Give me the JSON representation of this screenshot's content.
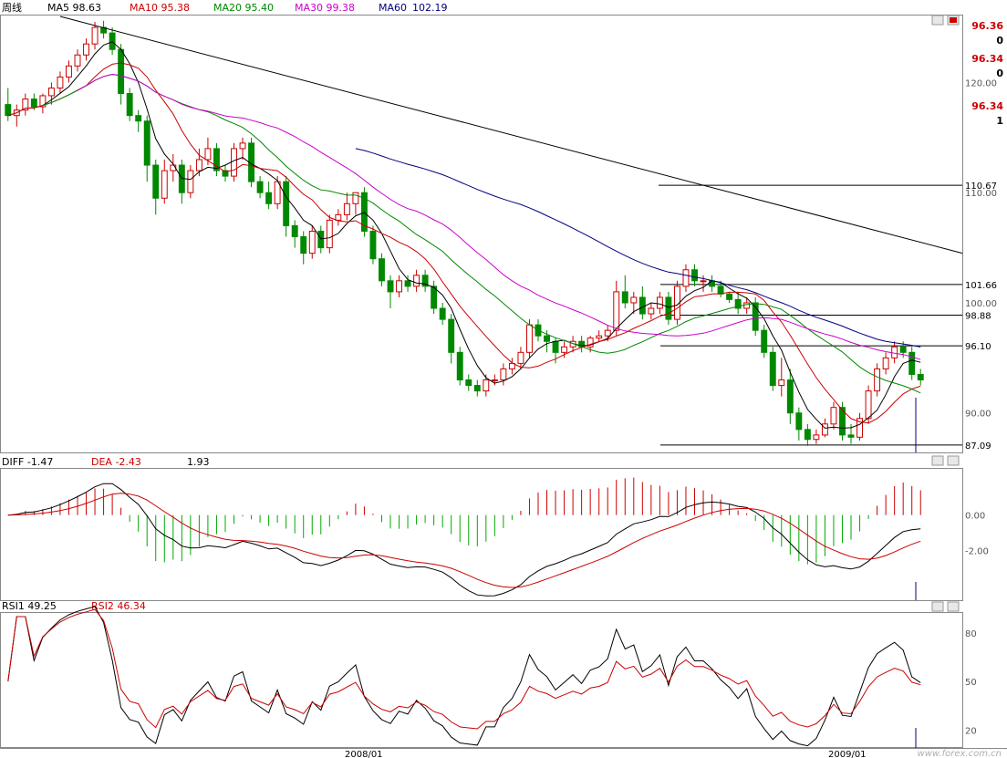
{
  "header": {
    "period": "周线",
    "ma5": "MA5 98.63",
    "ma10": "MA10 95.38",
    "ma20": "MA20 95.40",
    "ma30": "MA30 99.38",
    "ma60": "MA60",
    "ma60_value": "102.19"
  },
  "quote": {
    "line1": "96.36",
    "line1b": "0",
    "line2": "96.34",
    "line2b": "0",
    "line3": "96.34",
    "line3b": "1"
  },
  "macd_header": {
    "diff": "DIFF  -1.47",
    "dea": "DEA  -2.43",
    "macd": "1.93"
  },
  "rsi_header": {
    "rsi1": "RSI1   49.25",
    "rsi2": "RSI2   46.34"
  },
  "x_labels": [
    "2008/01",
    "2009/01"
  ],
  "watermark": "www.forex.com.cn",
  "colors": {
    "up": "#cc0000",
    "down": "#008800",
    "ma5": "#000000",
    "ma10": "#cc0000",
    "ma20": "#008800",
    "ma30": "#cc00cc",
    "ma60": "#000080",
    "hist_pos": "#cc0000",
    "hist_neg": "#00aa00"
  },
  "chart_data": [
    {
      "type": "candlestick",
      "panel": "price",
      "ylim": [
        86.5,
        126
      ],
      "y_ticks": [
        "120.00",
        "110.00",
        "100.00",
        "90.00"
      ],
      "levels": [
        "110.67",
        "101.66",
        "98.88",
        "96.10",
        "87.09"
      ],
      "level_values": [
        110.67,
        101.66,
        98.88,
        96.1,
        87.09
      ],
      "ohlc": [
        [
          118,
          119.5,
          116.5,
          117
        ],
        [
          117,
          118,
          116,
          117.5
        ],
        [
          117.5,
          119,
          117,
          118.5
        ],
        [
          118.5,
          119,
          117.5,
          117.8
        ],
        [
          117.8,
          119,
          117.2,
          118.8
        ],
        [
          118.8,
          120,
          118,
          119.5
        ],
        [
          119.5,
          121,
          119,
          120.5
        ],
        [
          120.5,
          122,
          120,
          121.5
        ],
        [
          121.5,
          123,
          121,
          122.5
        ],
        [
          122.5,
          124,
          122,
          123.5
        ],
        [
          123.5,
          125.5,
          123,
          125
        ],
        [
          125,
          125.6,
          124,
          124.5
        ],
        [
          124.5,
          125,
          122.5,
          123
        ],
        [
          123,
          123.5,
          118,
          119
        ],
        [
          119,
          119.5,
          116.5,
          117
        ],
        [
          117,
          117.5,
          115.5,
          116.5
        ],
        [
          116.5,
          117,
          111,
          112.5
        ],
        [
          112.5,
          113,
          108,
          109.5
        ],
        [
          109.5,
          113,
          109,
          112
        ],
        [
          112,
          113.5,
          111,
          112.5
        ],
        [
          112.5,
          113,
          109,
          110
        ],
        [
          110,
          112.5,
          109.5,
          112
        ],
        [
          112,
          114,
          111.5,
          113
        ],
        [
          113,
          115,
          112.5,
          114
        ],
        [
          114,
          114.5,
          111.5,
          112
        ],
        [
          112,
          112.5,
          111,
          111.5
        ],
        [
          111.5,
          114.5,
          111,
          114
        ],
        [
          114,
          115,
          113,
          114.5
        ],
        [
          114.5,
          115,
          110.5,
          111
        ],
        [
          111,
          111.5,
          109.5,
          110
        ],
        [
          110,
          111,
          108.5,
          109
        ],
        [
          109,
          111.5,
          108.5,
          111
        ],
        [
          111,
          111.5,
          106,
          107
        ],
        [
          107,
          107.5,
          105,
          106
        ],
        [
          106,
          106.5,
          103.5,
          104.5
        ],
        [
          104.5,
          107,
          104,
          106.5
        ],
        [
          106.5,
          107,
          104.5,
          105
        ],
        [
          105,
          108,
          104.5,
          107.5
        ],
        [
          107.5,
          108.5,
          107,
          108
        ],
        [
          108,
          110,
          107.5,
          109
        ],
        [
          109,
          110,
          108,
          110
        ],
        [
          110,
          110.5,
          106,
          106.5
        ],
        [
          106.5,
          107,
          103.5,
          104
        ],
        [
          104,
          104.5,
          101.5,
          102
        ],
        [
          102,
          102.5,
          99.5,
          101
        ],
        [
          101,
          102.5,
          100.5,
          102
        ],
        [
          102,
          102.5,
          101,
          101.5
        ],
        [
          101.5,
          103,
          101,
          102.5
        ],
        [
          102.5,
          103,
          101,
          101.5
        ],
        [
          101.5,
          102,
          99,
          99.5
        ],
        [
          99.5,
          100,
          98,
          98.5
        ],
        [
          98.5,
          99,
          94.5,
          95.5
        ],
        [
          95.5,
          96,
          92.5,
          93
        ],
        [
          93,
          93.5,
          92,
          92.5
        ],
        [
          92.5,
          93,
          91.5,
          92
        ],
        [
          92,
          93.5,
          91.5,
          93
        ],
        [
          93,
          93.5,
          92.5,
          93
        ],
        [
          93,
          94.5,
          92.5,
          94
        ],
        [
          94,
          95,
          93.5,
          94.5
        ],
        [
          94.5,
          96,
          94,
          95.5
        ],
        [
          95.5,
          98.5,
          95,
          98
        ],
        [
          98,
          98.5,
          96.5,
          97
        ],
        [
          97,
          97.5,
          95.5,
          96.5
        ],
        [
          96.5,
          96.8,
          94.5,
          95.5
        ],
        [
          95.5,
          96.5,
          95,
          96
        ],
        [
          96,
          97,
          95.5,
          96.5
        ],
        [
          96.5,
          97,
          95.5,
          96
        ],
        [
          96,
          97,
          95.5,
          96.8
        ],
        [
          96.8,
          97.5,
          96.5,
          97
        ],
        [
          97,
          98,
          96.5,
          97.5
        ],
        [
          97.5,
          102,
          97,
          101
        ],
        [
          101,
          102.5,
          99.5,
          100
        ],
        [
          100,
          101,
          99,
          100.5
        ],
        [
          100.5,
          101.5,
          98.5,
          99
        ],
        [
          99,
          100,
          98.5,
          99.5
        ],
        [
          99.5,
          101,
          99,
          100.5
        ],
        [
          100.5,
          101,
          98,
          98.5
        ],
        [
          98.5,
          102,
          98,
          101.5
        ],
        [
          101.5,
          103.5,
          101,
          103
        ],
        [
          103,
          103.5,
          101.5,
          102
        ],
        [
          102,
          102.5,
          101,
          102
        ],
        [
          102,
          102.5,
          101,
          101.5
        ],
        [
          101.5,
          102,
          100.5,
          100.8
        ],
        [
          100.8,
          101,
          100,
          100.3
        ],
        [
          100.3,
          101,
          99,
          99.5
        ],
        [
          99.5,
          100.5,
          99,
          100
        ],
        [
          100,
          100.5,
          97,
          97.5
        ],
        [
          97.5,
          98,
          95,
          95.5
        ],
        [
          95.5,
          96,
          92,
          92.5
        ],
        [
          92.5,
          95,
          91.5,
          93
        ],
        [
          93,
          94,
          89,
          90
        ],
        [
          90,
          90.5,
          87.5,
          88.5
        ],
        [
          88.5,
          89,
          87,
          87.6
        ],
        [
          87.6,
          88.5,
          87.2,
          88
        ],
        [
          88,
          89.5,
          87.8,
          89
        ],
        [
          89,
          91,
          88.5,
          90.5
        ],
        [
          90.5,
          91,
          87.5,
          88
        ],
        [
          88,
          89,
          87.2,
          87.8
        ],
        [
          87.8,
          90,
          87.5,
          89.5
        ],
        [
          89.5,
          92.5,
          89,
          92
        ],
        [
          92,
          94.5,
          91.5,
          94
        ],
        [
          94,
          95.5,
          93.5,
          95
        ],
        [
          95,
          96.5,
          94.5,
          96
        ],
        [
          96,
          96.5,
          95,
          95.5
        ],
        [
          95.5,
          96,
          93,
          93.5
        ],
        [
          93.5,
          94,
          92.5,
          93
        ]
      ]
    },
    {
      "type": "line",
      "panel": "macd",
      "ylim": [
        -4.7,
        2.3
      ],
      "y_ticks": [
        "0.00",
        "-2.00"
      ],
      "y_tick_values": [
        0,
        -2
      ]
    },
    {
      "type": "line",
      "panel": "rsi",
      "ylim": [
        10,
        90
      ],
      "y_ticks": [
        "80",
        "50",
        "20"
      ],
      "y_tick_values": [
        80,
        50,
        20
      ]
    }
  ]
}
